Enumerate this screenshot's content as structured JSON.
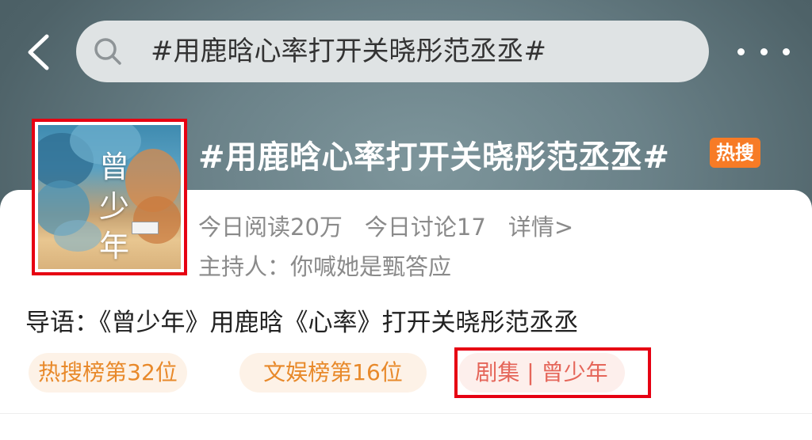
{
  "search": {
    "query": "#用鹿晗心率打开关晓彤范丞丞#"
  },
  "topic": {
    "title": "#用鹿晗心率打开关晓彤范丞丞#",
    "badge": "热搜",
    "badge_color": "#f77b26",
    "reads": "今日阅读20万",
    "discussions": "今日讨论17",
    "details_link": "详情>",
    "host_label": "主持人：",
    "host_name": "你喊她是甄答应"
  },
  "poster": {
    "title_chars": [
      "曾",
      "少",
      "年"
    ]
  },
  "intro": {
    "label": "导语：",
    "text": "《曾少年》用鹿晗《心率》打开关晓彤范丞丞"
  },
  "tags": [
    {
      "label": "热搜榜第32位"
    },
    {
      "label": "文娱榜第16位"
    },
    {
      "label": "剧集 | 曾少年"
    }
  ],
  "colors": {
    "highlight_box": "#e60012",
    "tag_text": "#e8892a",
    "accent": "#f77b26"
  }
}
